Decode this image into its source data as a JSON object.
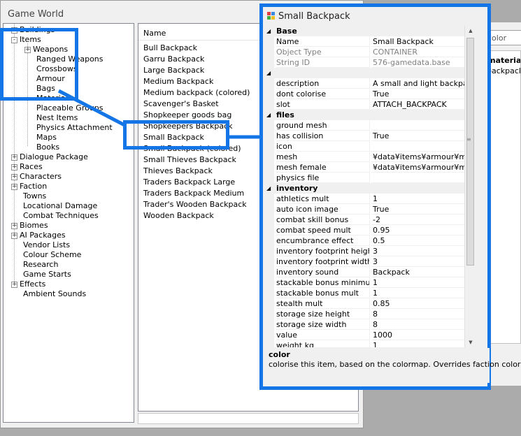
{
  "main": {
    "title": "Game World",
    "tree": [
      {
        "label": "Buildings",
        "expander": "+"
      },
      {
        "label": "Items",
        "expander": "-"
      },
      {
        "label": "Weapons",
        "expander": "+"
      },
      {
        "label": "Ranged Weapons",
        "expander": ""
      },
      {
        "label": "Crossbows",
        "expander": ""
      },
      {
        "label": "Armour",
        "expander": ""
      },
      {
        "label": "Bags",
        "expander": ""
      },
      {
        "label": "Materials",
        "expander": ""
      },
      {
        "label": "Placeable Groups",
        "expander": ""
      },
      {
        "label": "Nest Items",
        "expander": ""
      },
      {
        "label": "Physics Attachment",
        "expander": ""
      },
      {
        "label": "Maps",
        "expander": ""
      },
      {
        "label": "Books",
        "expander": ""
      },
      {
        "label": "Dialogue Package",
        "expander": "+"
      },
      {
        "label": "Races",
        "expander": "+"
      },
      {
        "label": "Characters",
        "expander": "+"
      },
      {
        "label": "Faction",
        "expander": "+"
      },
      {
        "label": "Towns",
        "expander": ""
      },
      {
        "label": "Locational Damage",
        "expander": ""
      },
      {
        "label": "Combat Techniques",
        "expander": ""
      },
      {
        "label": "Biomes",
        "expander": "+"
      },
      {
        "label": "AI Packages",
        "expander": "+"
      },
      {
        "label": "Vendor Lists",
        "expander": ""
      },
      {
        "label": "Colour Scheme",
        "expander": ""
      },
      {
        "label": "Research",
        "expander": ""
      },
      {
        "label": "Game Starts",
        "expander": ""
      },
      {
        "label": "Effects",
        "expander": "+"
      },
      {
        "label": "Ambient Sounds",
        "expander": ""
      }
    ],
    "list_header": "Name",
    "list": [
      "Bull Backpack",
      "Garru Backpack",
      "Large Backpack",
      "Medium Backpack",
      "Medium backpack (colored)",
      "Scavenger's Basket",
      "Shopkeeper goods bag",
      "Shopkeepers Backpack",
      "Small Backpack",
      "Small Backpack (colored)",
      "Small Thieves Backpack",
      "Thieves Backpack",
      "Traders Backpack Large",
      "Traders Backpack Medium",
      "Trader's Wooden Backpack",
      "Wooden Backpack"
    ]
  },
  "back_panel": {
    "combo_value": "color",
    "header": "materia",
    "item": "backpack"
  },
  "props": {
    "title": "Small Backpack",
    "rows": [
      {
        "type": "cat",
        "name": "Base"
      },
      {
        "type": "prop",
        "name": "Name",
        "value": "Small Backpack",
        "ro": false
      },
      {
        "type": "prop",
        "name": "Object Type",
        "value": "CONTAINER",
        "ro": true
      },
      {
        "type": "prop",
        "name": "String ID",
        "value": "576-gamedata.base",
        "ro": true
      },
      {
        "type": "cat",
        "name": ""
      },
      {
        "type": "prop",
        "name": "description",
        "value": "A small and light backpack",
        "ro": false
      },
      {
        "type": "prop",
        "name": "dont colorise",
        "value": "True",
        "ro": false
      },
      {
        "type": "prop",
        "name": "slot",
        "value": "ATTACH_BACKPACK",
        "ro": false
      },
      {
        "type": "cat",
        "name": "files"
      },
      {
        "type": "prop",
        "name": "ground mesh",
        "value": "",
        "ro": false
      },
      {
        "type": "prop",
        "name": "has collision",
        "value": "True",
        "ro": false
      },
      {
        "type": "prop",
        "name": "icon",
        "value": "",
        "ro": false
      },
      {
        "type": "prop",
        "name": "mesh",
        "value": "¥data¥items¥armour¥mesh",
        "ro": false
      },
      {
        "type": "prop",
        "name": "mesh female",
        "value": "¥data¥items¥armour¥mesh",
        "ro": false
      },
      {
        "type": "prop",
        "name": "physics file",
        "value": "",
        "ro": false
      },
      {
        "type": "cat",
        "name": "inventory"
      },
      {
        "type": "prop",
        "name": "athletics mult",
        "value": "1",
        "ro": false
      },
      {
        "type": "prop",
        "name": "auto icon image",
        "value": "True",
        "ro": false
      },
      {
        "type": "prop",
        "name": "combat skill bonus",
        "value": "-2",
        "ro": false
      },
      {
        "type": "prop",
        "name": "combat speed mult",
        "value": "0.95",
        "ro": false
      },
      {
        "type": "prop",
        "name": "encumbrance effect",
        "value": "0.5",
        "ro": false
      },
      {
        "type": "prop",
        "name": "inventory footprint height",
        "value": "3",
        "ro": false
      },
      {
        "type": "prop",
        "name": "inventory footprint width",
        "value": "3",
        "ro": false
      },
      {
        "type": "prop",
        "name": "inventory sound",
        "value": "Backpack",
        "ro": false
      },
      {
        "type": "prop",
        "name": "stackable bonus minimum",
        "value": "1",
        "ro": false
      },
      {
        "type": "prop",
        "name": "stackable bonus mult",
        "value": "1",
        "ro": false
      },
      {
        "type": "prop",
        "name": "stealth mult",
        "value": "0.85",
        "ro": false
      },
      {
        "type": "prop",
        "name": "storage size height",
        "value": "8",
        "ro": false
      },
      {
        "type": "prop",
        "name": "storage size width",
        "value": "8",
        "ro": false
      },
      {
        "type": "prop",
        "name": "value",
        "value": "1000",
        "ro": false
      },
      {
        "type": "prop",
        "name": "weight kg",
        "value": "1",
        "ro": false
      }
    ],
    "description_title": "color",
    "description_text": "colorise this item, based on the colormap. Overrides faction coloriser"
  },
  "colors": {
    "highlight": "#1475e6",
    "readonly_text": "#808080"
  }
}
